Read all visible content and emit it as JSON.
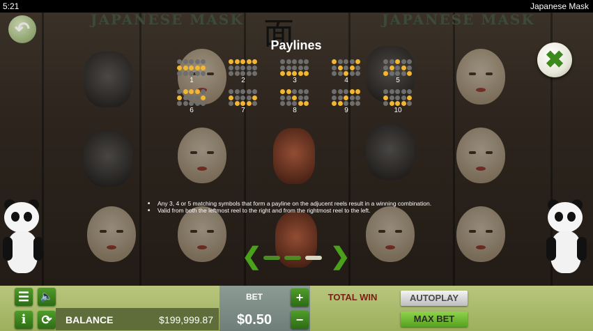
{
  "status_bar": {
    "clock": "5:21",
    "game_title": "Japanese Mask"
  },
  "header": {
    "title_left": "JAPANESE MASK",
    "title_right": "JAPANESE MASK",
    "kanji": "面"
  },
  "paylines": {
    "title": "Paylines",
    "items": [
      {
        "label": "1",
        "rows": [
          [
            0,
            0,
            0,
            0,
            0
          ],
          [
            1,
            1,
            1,
            1,
            1
          ],
          [
            0,
            0,
            0,
            0,
            0
          ]
        ]
      },
      {
        "label": "2",
        "rows": [
          [
            1,
            1,
            1,
            1,
            1
          ],
          [
            0,
            0,
            0,
            0,
            0
          ],
          [
            0,
            0,
            0,
            0,
            0
          ]
        ]
      },
      {
        "label": "3",
        "rows": [
          [
            0,
            0,
            0,
            0,
            0
          ],
          [
            0,
            0,
            0,
            0,
            0
          ],
          [
            1,
            1,
            1,
            1,
            1
          ]
        ]
      },
      {
        "label": "4",
        "rows": [
          [
            1,
            0,
            0,
            0,
            1
          ],
          [
            0,
            1,
            0,
            1,
            0
          ],
          [
            0,
            0,
            1,
            0,
            0
          ]
        ]
      },
      {
        "label": "5",
        "rows": [
          [
            0,
            0,
            1,
            0,
            0
          ],
          [
            0,
            1,
            0,
            1,
            0
          ],
          [
            1,
            0,
            0,
            0,
            1
          ]
        ]
      },
      {
        "label": "6",
        "rows": [
          [
            0,
            1,
            1,
            1,
            0
          ],
          [
            1,
            0,
            0,
            0,
            1
          ],
          [
            0,
            0,
            0,
            0,
            0
          ]
        ]
      },
      {
        "label": "7",
        "rows": [
          [
            0,
            0,
            0,
            0,
            0
          ],
          [
            1,
            0,
            0,
            0,
            1
          ],
          [
            0,
            1,
            1,
            1,
            0
          ]
        ]
      },
      {
        "label": "8",
        "rows": [
          [
            1,
            1,
            0,
            0,
            0
          ],
          [
            0,
            0,
            1,
            0,
            0
          ],
          [
            0,
            0,
            0,
            1,
            1
          ]
        ]
      },
      {
        "label": "9",
        "rows": [
          [
            0,
            0,
            0,
            1,
            1
          ],
          [
            0,
            0,
            1,
            0,
            0
          ],
          [
            1,
            1,
            0,
            0,
            0
          ]
        ]
      },
      {
        "label": "10",
        "rows": [
          [
            0,
            0,
            0,
            0,
            0
          ],
          [
            1,
            0,
            0,
            0,
            1
          ],
          [
            0,
            1,
            1,
            1,
            0
          ]
        ]
      }
    ],
    "rules": [
      "Any 3, 4 or 5 matching symbols that form a payline on the adjucent reels result in a winning combination.",
      "Valid from both the leftmost reel to the right and from the rightmost reel to the left."
    ],
    "pager": {
      "pages": 3,
      "active_page": 3
    }
  },
  "controls": {
    "close_glyph": "✖",
    "back_glyph": "↶",
    "prev_glyph": "❮",
    "next_glyph": "❯",
    "paytable_glyph": "☰",
    "sound_glyph": "🔈",
    "info_glyph": "i",
    "reload_glyph": "⟳",
    "plus_glyph": "+",
    "minus_glyph": "−",
    "balance_label": "BALANCE",
    "balance_value": "$199,999.87",
    "bet_label": "BET",
    "bet_value": "$0.50",
    "total_win_label": "TOTAL WIN",
    "autoplay_label": "AUTOPLAY",
    "max_bet_label": "MAX BET"
  },
  "colors": {
    "accent_green": "#49a11c",
    "payline_on": "#f2b632",
    "payline_off": "#6e6e6e"
  }
}
